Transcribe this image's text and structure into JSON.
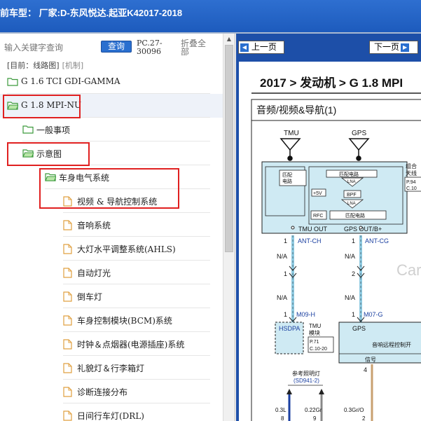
{
  "window": {
    "title": "前车型：  厂家:D-东风悦达.起亚K42017-2018"
  },
  "left": {
    "search_placeholder": "输入关键字查询",
    "query_label": "查询",
    "pc_code": "PC.27-30096",
    "collapse_all": "折叠全部",
    "breadcrumb": "[目前：线路图]",
    "breadcrumb_sub": "[机制]",
    "tree": [
      {
        "label": "G 1.6 TCI GDI-GAMMA",
        "type": "folder",
        "level": 0
      },
      {
        "label": "G 1.8 MPI-NU",
        "type": "folder-open",
        "level": 0,
        "selected": true
      },
      {
        "label": "一般事项",
        "type": "folder",
        "level": 1
      },
      {
        "label": "示意图",
        "type": "folder-open",
        "level": 1
      },
      {
        "label": "车身电气系统",
        "type": "folder-open",
        "level": 2
      },
      {
        "label": "视频 & 导航控制系统",
        "type": "file",
        "level": 3
      },
      {
        "label": "音响系统",
        "type": "file",
        "level": 3
      },
      {
        "label": "大灯水平调整系统(AHLS)",
        "type": "file",
        "level": 3
      },
      {
        "label": "自动灯光",
        "type": "file",
        "level": 3
      },
      {
        "label": "倒车灯",
        "type": "file",
        "level": 3
      },
      {
        "label": "车身控制模块(BCM)系统",
        "type": "file",
        "level": 3
      },
      {
        "label": "时钟＆点烟器(电源插座)系统",
        "type": "file",
        "level": 3
      },
      {
        "label": "礼貌灯＆行李箱灯",
        "type": "file",
        "level": 3
      },
      {
        "label": "诊断连接分布",
        "type": "file",
        "level": 3
      },
      {
        "label": "日间行车灯(DRL)",
        "type": "file",
        "level": 3
      }
    ]
  },
  "right": {
    "prev_label": "上一页",
    "next_label": "下一页",
    "doc_title": "2017 > 发动机 > G 1.8 MPI",
    "diagram": {
      "section": "音频/视频&导航(1)",
      "tmu": "TMU",
      "gps": "GPS",
      "match_circuit": "匹配电路",
      "match_circuit_short": "匹配\n电路",
      "lna": "LNA",
      "bpf": "BPF",
      "plus5v": "+5V",
      "rfc": "RFC",
      "tmu_out": "TMU OUT",
      "gps_out": "GPS OUT/B+",
      "combo": "组合",
      "antenna": "天线",
      "ref_p94": "P.94",
      "ref_c10": "C.10",
      "pin1": "1",
      "pin2": "2",
      "pin4": "4",
      "ant_ch": "ANT-CH",
      "ant_cg": "ANT-CG",
      "na": "N/A",
      "m09h": "M09-H",
      "m07g": "M07-G",
      "hsdpa": "HSDPA",
      "tmu_module": "TMU",
      "module": "模块",
      "ref_p71": "P.71",
      "ref_c1020": "C.10-20",
      "gps_label": "GPS",
      "remote_ctrl": "音响远程控制开",
      "signal": "信号",
      "ref_light": "参考照明灯",
      "ref_sd": "(SD941-2)",
      "w1": "0.3L",
      "w2": "0.22Gr",
      "w3": "0.3Gr/O",
      "pin8": "8",
      "pin9": "9",
      "watermark": "Car"
    }
  }
}
